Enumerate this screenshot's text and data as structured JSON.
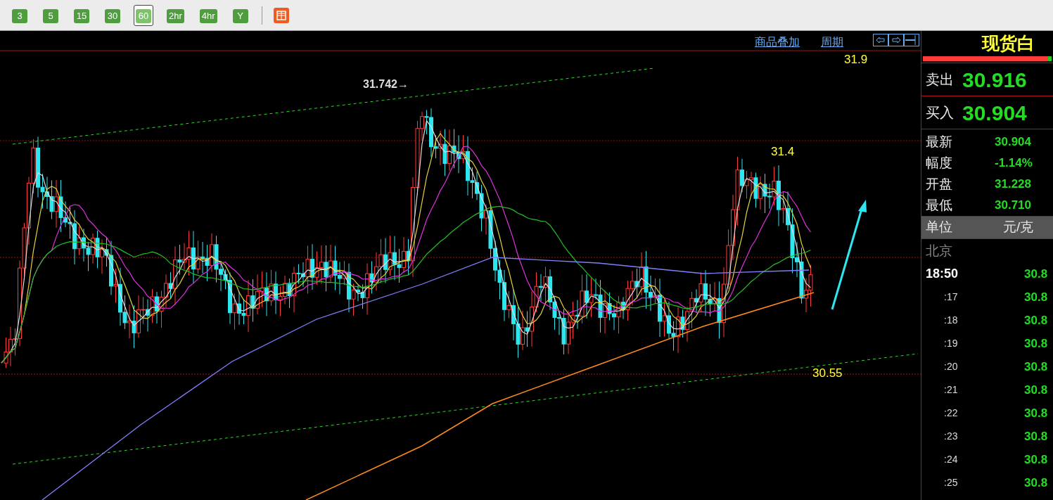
{
  "toolbar": {
    "periods": [
      {
        "label": "3",
        "selected": false
      },
      {
        "label": "5",
        "selected": false
      },
      {
        "label": "15",
        "selected": false
      },
      {
        "label": "30",
        "selected": false
      },
      {
        "label": "60",
        "selected": true
      },
      {
        "label": "2hr",
        "selected": false
      },
      {
        "label": "4hr",
        "selected": false
      },
      {
        "label": "Y",
        "selected": false
      }
    ]
  },
  "chart": {
    "links": [
      "商品叠加",
      "周期"
    ],
    "annotations": [
      {
        "kind": "peak",
        "text": "31.742→"
      },
      {
        "kind": "target",
        "text": "31.9"
      },
      {
        "kind": "level",
        "text": "31.4"
      },
      {
        "kind": "support",
        "text": "30.55"
      }
    ]
  },
  "quote": {
    "title": "现货白",
    "ratio_bar": {
      "level": 0.97
    },
    "sides": [
      {
        "label": "卖出",
        "price": "30.916"
      },
      {
        "label": "买入",
        "price": "30.904"
      }
    ],
    "stats": [
      {
        "label": "最新",
        "value": "30.904"
      },
      {
        "label": "幅度",
        "value": "-1.14%"
      },
      {
        "label": "开盘",
        "value": "31.228"
      },
      {
        "label": "最低",
        "value": "30.710"
      }
    ],
    "unit": {
      "label": "单位",
      "value": "元/克"
    },
    "ticks_header": "北京",
    "ticks": [
      {
        "kind": "hour",
        "time": "18:50",
        "price": "30.8"
      },
      {
        "kind": "minute",
        "time": ":17",
        "price": "30.8"
      },
      {
        "kind": "minute",
        "time": ":18",
        "price": "30.8"
      },
      {
        "kind": "minute",
        "time": ":19",
        "price": "30.8"
      },
      {
        "kind": "minute",
        "time": ":20",
        "price": "30.8"
      },
      {
        "kind": "minute",
        "time": ":21",
        "price": "30.8"
      },
      {
        "kind": "minute",
        "time": ":22",
        "price": "30.8"
      },
      {
        "kind": "minute",
        "time": ":23",
        "price": "30.8"
      },
      {
        "kind": "minute",
        "time": ":24",
        "price": "30.8"
      },
      {
        "kind": "minute",
        "time": ":25",
        "price": "30.8"
      }
    ]
  }
}
